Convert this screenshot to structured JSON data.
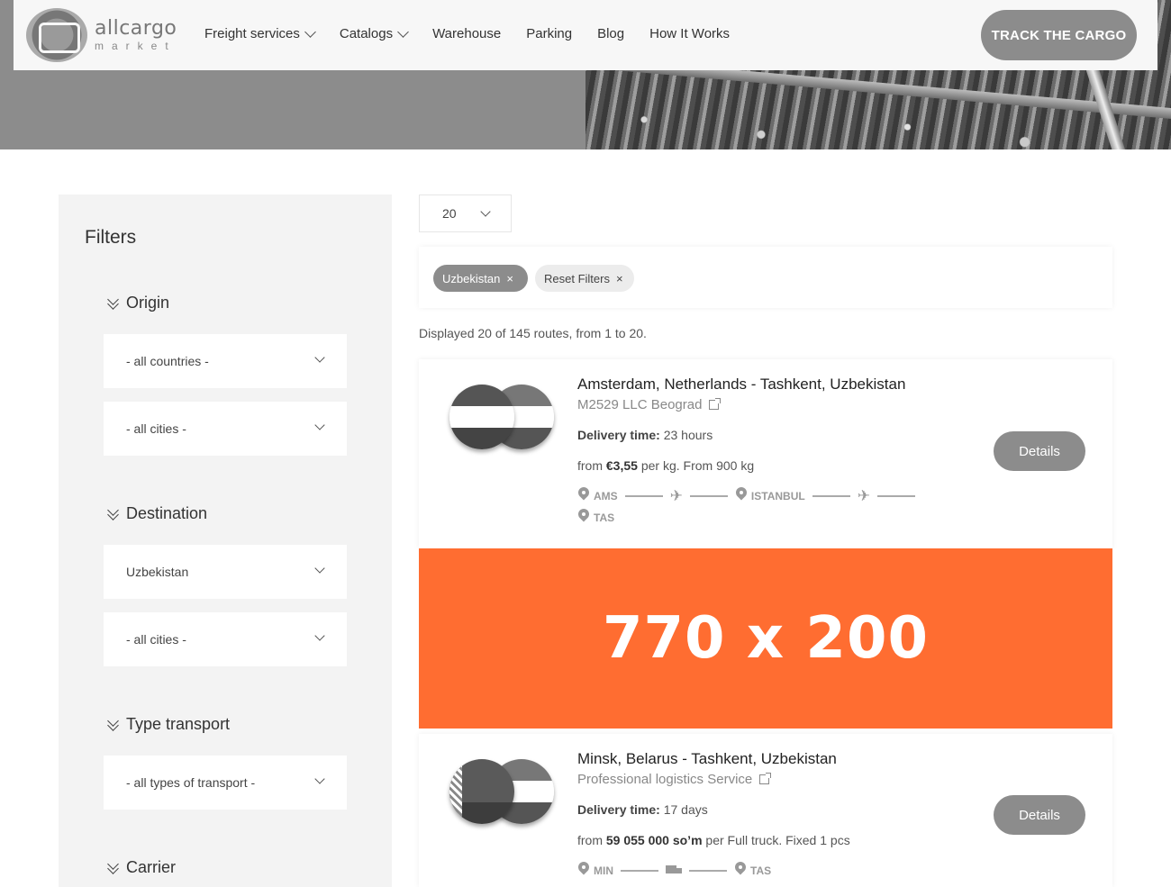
{
  "header": {
    "logo_word": "allcargo",
    "logo_sub": "market",
    "nav": [
      {
        "label": "Freight services",
        "dropdown": true
      },
      {
        "label": "Catalogs",
        "dropdown": true
      },
      {
        "label": "Warehouse",
        "dropdown": false
      },
      {
        "label": "Parking",
        "dropdown": false
      },
      {
        "label": "Blog",
        "dropdown": false
      },
      {
        "label": "How It Works",
        "dropdown": false
      }
    ],
    "track_button": "TRACK THE CARGO"
  },
  "filters": {
    "title": "Filters",
    "origin": {
      "title": "Origin",
      "country": "- all countries -",
      "city": "- all cities -"
    },
    "destination": {
      "title": "Destination",
      "country": "Uzbekistan",
      "city": "- all cities -"
    },
    "transport": {
      "title": "Type transport",
      "type": "- all types of transport -"
    },
    "carrier": {
      "title": "Carrier"
    }
  },
  "results": {
    "per_page": "20",
    "chips": [
      {
        "label": "Uzbekistan",
        "close": "×"
      },
      {
        "label": "Reset Filters",
        "close": "×"
      }
    ],
    "count_text": "Displayed 20 of 145 routes, from 1 to 20.",
    "banner_text": "770 x 200",
    "routes": [
      {
        "title": "Amsterdam, Netherlands - Tashkent, Uzbekistan",
        "carrier": "M2529 LLC Beograd",
        "delivery_label": "Delivery time:",
        "delivery_value": "23 hours",
        "price_prefix": "from",
        "price_value": "€3,55",
        "price_suffix": "per kg. From 900 kg",
        "stops": [
          "AMS",
          "ISTANBUL",
          "TAS"
        ],
        "details_label": "Details"
      },
      {
        "title": "Minsk, Belarus - Tashkent, Uzbekistan",
        "carrier": "Professional logistics Service",
        "delivery_label": "Delivery time:",
        "delivery_value": "17 days",
        "price_prefix": "from",
        "price_value": "59 055 000 so’m",
        "price_suffix": "per Full truck. Fixed 1 pcs",
        "stops": [
          "MIN",
          "TAS"
        ],
        "details_label": "Details"
      }
    ]
  },
  "colors": {
    "accent_gray": "#8c8c8c",
    "banner_orange": "#ff6d31",
    "panel_bg": "#f3f3f3"
  }
}
